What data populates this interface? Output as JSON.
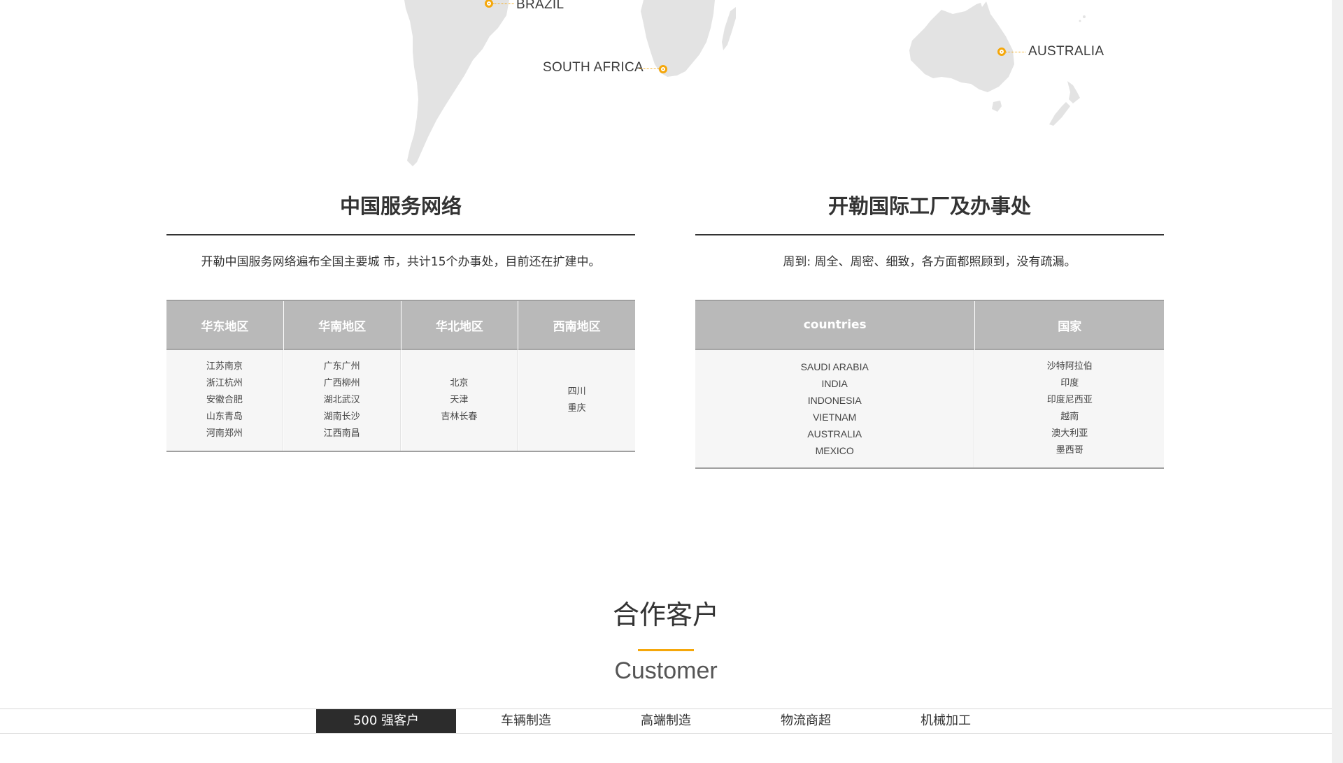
{
  "map": {
    "labels": {
      "brazil": "BRAZIL",
      "south_africa": "SOUTH AFRICA",
      "australia": "AUSTRALIA"
    },
    "pin_color": "#f5a70a",
    "land_color": "#e3e3e3"
  },
  "china_network": {
    "title": "中国服务网络",
    "description": "开勒中国服务网络遍布全国主要城 市，共计15个办事处，目前还在扩建中。",
    "columns": [
      {
        "header": "华东地区",
        "cities": [
          "江苏南京",
          "浙江杭州",
          "安徽合肥",
          "山东青岛",
          "河南郑州"
        ]
      },
      {
        "header": "华南地区",
        "cities": [
          "广东广州",
          "广西柳州",
          "湖北武汉",
          "湖南长沙",
          "江西南昌"
        ]
      },
      {
        "header": "华北地区",
        "cities": [
          "北京",
          "天津",
          "吉林长春"
        ]
      },
      {
        "header": "西南地区",
        "cities": [
          "四川",
          "重庆"
        ]
      }
    ]
  },
  "international": {
    "title": "开勒国际工厂及办事处",
    "description": "周到: 周全、周密、细致，各方面都照顾到，没有疏漏。",
    "columns": [
      {
        "header": "countries",
        "cities": [
          "SAUDI ARABIA",
          "INDIA",
          "INDONESIA",
          "VIETNAM",
          "AUSTRALIA",
          "MEXICO"
        ]
      },
      {
        "header": "国家",
        "cities": [
          "沙特阿拉伯",
          "印度",
          "印度尼西亚",
          "越南",
          "澳大利亚",
          "墨西哥"
        ]
      }
    ]
  },
  "customer": {
    "title": "合作客户",
    "subtitle": "Customer",
    "accent": "#f5a70a",
    "tabs": [
      {
        "label": "500 强客户",
        "active": true
      },
      {
        "label": "车辆制造",
        "active": false
      },
      {
        "label": "高端制造",
        "active": false
      },
      {
        "label": "物流商超",
        "active": false
      },
      {
        "label": "机械加工",
        "active": false
      }
    ]
  }
}
